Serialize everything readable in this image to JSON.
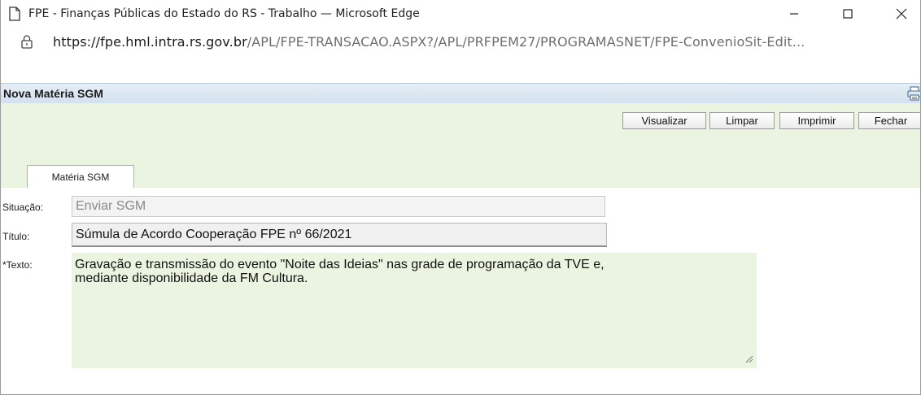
{
  "window": {
    "title": "FPE - Finanças Públicas do Estado do RS - Trabalho — Microsoft Edge",
    "url_host": "https://fpe.hml.intra.rs.gov.br",
    "url_path": "/APL/FPE-TRANSACAO.ASPX?/APL/PRFPEM27/PROGRAMASNET/FPE-ConvenioSit-Edit...",
    "controls": {
      "minimize": "minimize-icon",
      "maximize": "maximize-icon",
      "close": "close-icon"
    }
  },
  "app": {
    "title": "Nova Matéria SGM",
    "print_icon": "printer-icon"
  },
  "toolbar": {
    "visualizar": "Visualizar",
    "limpar": "Limpar",
    "imprimir": "Imprimir",
    "fechar": "Fechar"
  },
  "tabs": [
    {
      "label": "Matéria SGM",
      "active": true
    }
  ],
  "form": {
    "situacao_label": "Situação:",
    "situacao_value": "Enviar SGM",
    "titulo_label": "Título:",
    "titulo_value": "Súmula de Acordo Cooperação FPE nº 66/2021",
    "texto_label": "*Texto:",
    "texto_value": "Gravação e transmissão do evento \"Noite das Ideias\" nas grade de programação da TVE e,\nmediante disponibilidade da FM Cultura."
  },
  "colors": {
    "toolbar_bg": "#ebf4e0",
    "header_bg": "#d3e1ee"
  }
}
